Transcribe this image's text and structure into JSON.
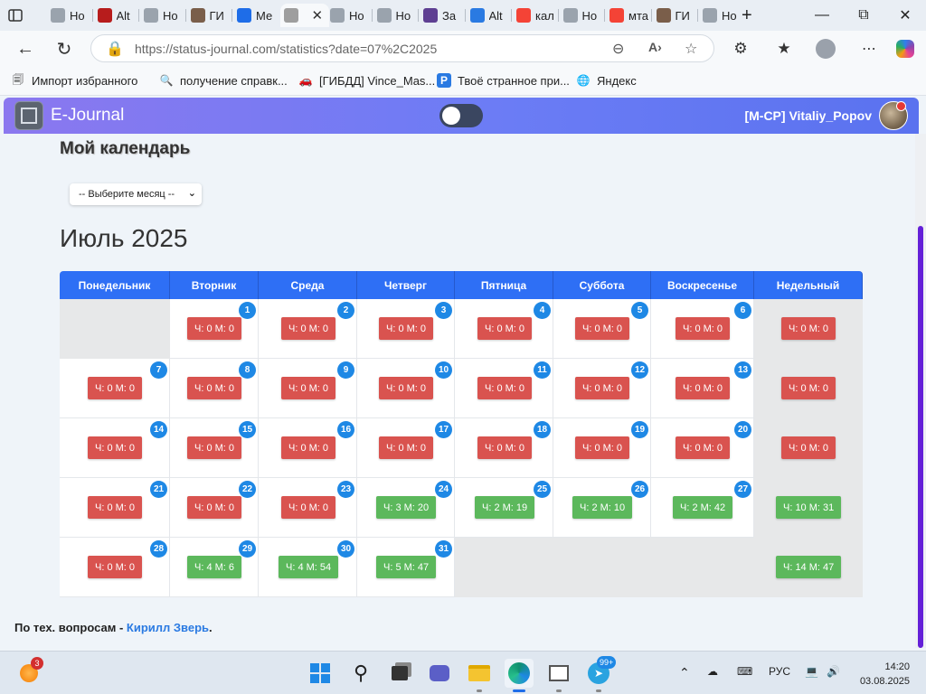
{
  "browser": {
    "tabs": [
      {
        "label": "Но",
        "icon": "page-icon",
        "color": "#9aa3ad"
      },
      {
        "label": "Alt",
        "icon": "car-logo-icon",
        "color": "#b71c1c"
      },
      {
        "label": "Но",
        "icon": "page-icon",
        "color": "#9aa3ad"
      },
      {
        "label": "ГИ",
        "icon": "car-icon",
        "color": "#7a5e4a"
      },
      {
        "label": "Ме",
        "icon": "chat-icon",
        "color": "#1e6de8"
      },
      {
        "label": "",
        "icon": "person-icon",
        "color": "#9e9e9e"
      },
      {
        "label": "Но",
        "icon": "page-icon",
        "color": "#9aa3ad"
      },
      {
        "label": "Но",
        "icon": "page-icon",
        "color": "#9aa3ad"
      },
      {
        "label": "За",
        "icon": "yandex-forms-icon",
        "color": "#5e3f92"
      },
      {
        "label": "Alt",
        "icon": "p-logo-icon",
        "color": "#2a7ae2"
      },
      {
        "label": "кал",
        "icon": "yandex-icon",
        "color": "#f44336"
      },
      {
        "label": "Но",
        "icon": "page-icon",
        "color": "#9aa3ad"
      },
      {
        "label": "мта",
        "icon": "yandex-icon",
        "color": "#f44336"
      },
      {
        "label": "ГИ",
        "icon": "car-icon",
        "color": "#7a5e4a"
      },
      {
        "label": "Но",
        "icon": "page-icon",
        "color": "#9aa3ad"
      }
    ],
    "new_tab_label": "+",
    "url": "https://status-journal.com/statistics?date=07%2C2025",
    "favorites": [
      {
        "label": "Импорт избранного",
        "icon": "import-icon"
      },
      {
        "label": "получение справк...",
        "icon": "search-icon"
      },
      {
        "label": "[ГИБДД] Vince_Mas...",
        "icon": "car-icon"
      },
      {
        "label": "Твоё странное при...",
        "icon": "p-logo-icon"
      },
      {
        "label": "Яндекс",
        "icon": "globe-icon"
      }
    ]
  },
  "app": {
    "name": "E-Journal",
    "user": "[M-CP] Vitaliy_Popov",
    "page_title": "Мой календарь",
    "month_select": "-- Выберите месяц --",
    "month_title": "Июль 2025",
    "weekday_headers": [
      "Понедельник",
      "Вторник",
      "Среда",
      "Четверг",
      "Пятница",
      "Суббота",
      "Воскресенье",
      "Недельный"
    ],
    "weeks": [
      {
        "days": [
          null,
          {
            "n": "1",
            "v": "Ч: 0 М: 0",
            "c": "red"
          },
          {
            "n": "2",
            "v": "Ч: 0 М: 0",
            "c": "red"
          },
          {
            "n": "3",
            "v": "Ч: 0 М: 0",
            "c": "red"
          },
          {
            "n": "4",
            "v": "Ч: 0 М: 0",
            "c": "red"
          },
          {
            "n": "5",
            "v": "Ч: 0 М: 0",
            "c": "red"
          },
          {
            "n": "6",
            "v": "Ч: 0 М: 0",
            "c": "red"
          }
        ],
        "weekly": {
          "v": "Ч: 0 М: 0",
          "c": "red"
        }
      },
      {
        "days": [
          {
            "n": "7",
            "v": "Ч: 0 М: 0",
            "c": "red"
          },
          {
            "n": "8",
            "v": "Ч: 0 М: 0",
            "c": "red"
          },
          {
            "n": "9",
            "v": "Ч: 0 М: 0",
            "c": "red"
          },
          {
            "n": "10",
            "v": "Ч: 0 М: 0",
            "c": "red"
          },
          {
            "n": "11",
            "v": "Ч: 0 М: 0",
            "c": "red"
          },
          {
            "n": "12",
            "v": "Ч: 0 М: 0",
            "c": "red"
          },
          {
            "n": "13",
            "v": "Ч: 0 М: 0",
            "c": "red"
          }
        ],
        "weekly": {
          "v": "Ч: 0 М: 0",
          "c": "red"
        }
      },
      {
        "days": [
          {
            "n": "14",
            "v": "Ч: 0 М: 0",
            "c": "red"
          },
          {
            "n": "15",
            "v": "Ч: 0 М: 0",
            "c": "red"
          },
          {
            "n": "16",
            "v": "Ч: 0 М: 0",
            "c": "red"
          },
          {
            "n": "17",
            "v": "Ч: 0 М: 0",
            "c": "red"
          },
          {
            "n": "18",
            "v": "Ч: 0 М: 0",
            "c": "red"
          },
          {
            "n": "19",
            "v": "Ч: 0 М: 0",
            "c": "red"
          },
          {
            "n": "20",
            "v": "Ч: 0 М: 0",
            "c": "red"
          }
        ],
        "weekly": {
          "v": "Ч: 0 М: 0",
          "c": "red"
        }
      },
      {
        "days": [
          {
            "n": "21",
            "v": "Ч: 0 М: 0",
            "c": "red"
          },
          {
            "n": "22",
            "v": "Ч: 0 М: 0",
            "c": "red"
          },
          {
            "n": "23",
            "v": "Ч: 0 М: 0",
            "c": "red"
          },
          {
            "n": "24",
            "v": "Ч: 3 М: 20",
            "c": "green"
          },
          {
            "n": "25",
            "v": "Ч: 2 М: 19",
            "c": "green"
          },
          {
            "n": "26",
            "v": "Ч: 2 М: 10",
            "c": "green"
          },
          {
            "n": "27",
            "v": "Ч: 2 М: 42",
            "c": "green"
          }
        ],
        "weekly": {
          "v": "Ч: 10 М: 31",
          "c": "green"
        }
      },
      {
        "days": [
          {
            "n": "28",
            "v": "Ч: 0 М: 0",
            "c": "red"
          },
          {
            "n": "29",
            "v": "Ч: 4 М: 6",
            "c": "green"
          },
          {
            "n": "30",
            "v": "Ч: 4 М: 54",
            "c": "green"
          },
          {
            "n": "31",
            "v": "Ч: 5 М: 47",
            "c": "green"
          },
          null,
          null,
          null
        ],
        "weekly": {
          "v": "Ч: 14 М: 47",
          "c": "green"
        }
      }
    ],
    "footer_prefix": "По тех. вопросам - ",
    "footer_link": "Кирилл Зверь",
    "footer_suffix": "."
  },
  "colors": {
    "header_blue": "#2e6ff5",
    "day_badge": "#1e88e5",
    "status_red": "#d9534f",
    "status_green": "#5cb85c"
  },
  "taskbar": {
    "widget_badge": "3",
    "telegram_badge": "99+",
    "lang": "РУС",
    "time": "14:20",
    "date": "03.08.2025"
  }
}
